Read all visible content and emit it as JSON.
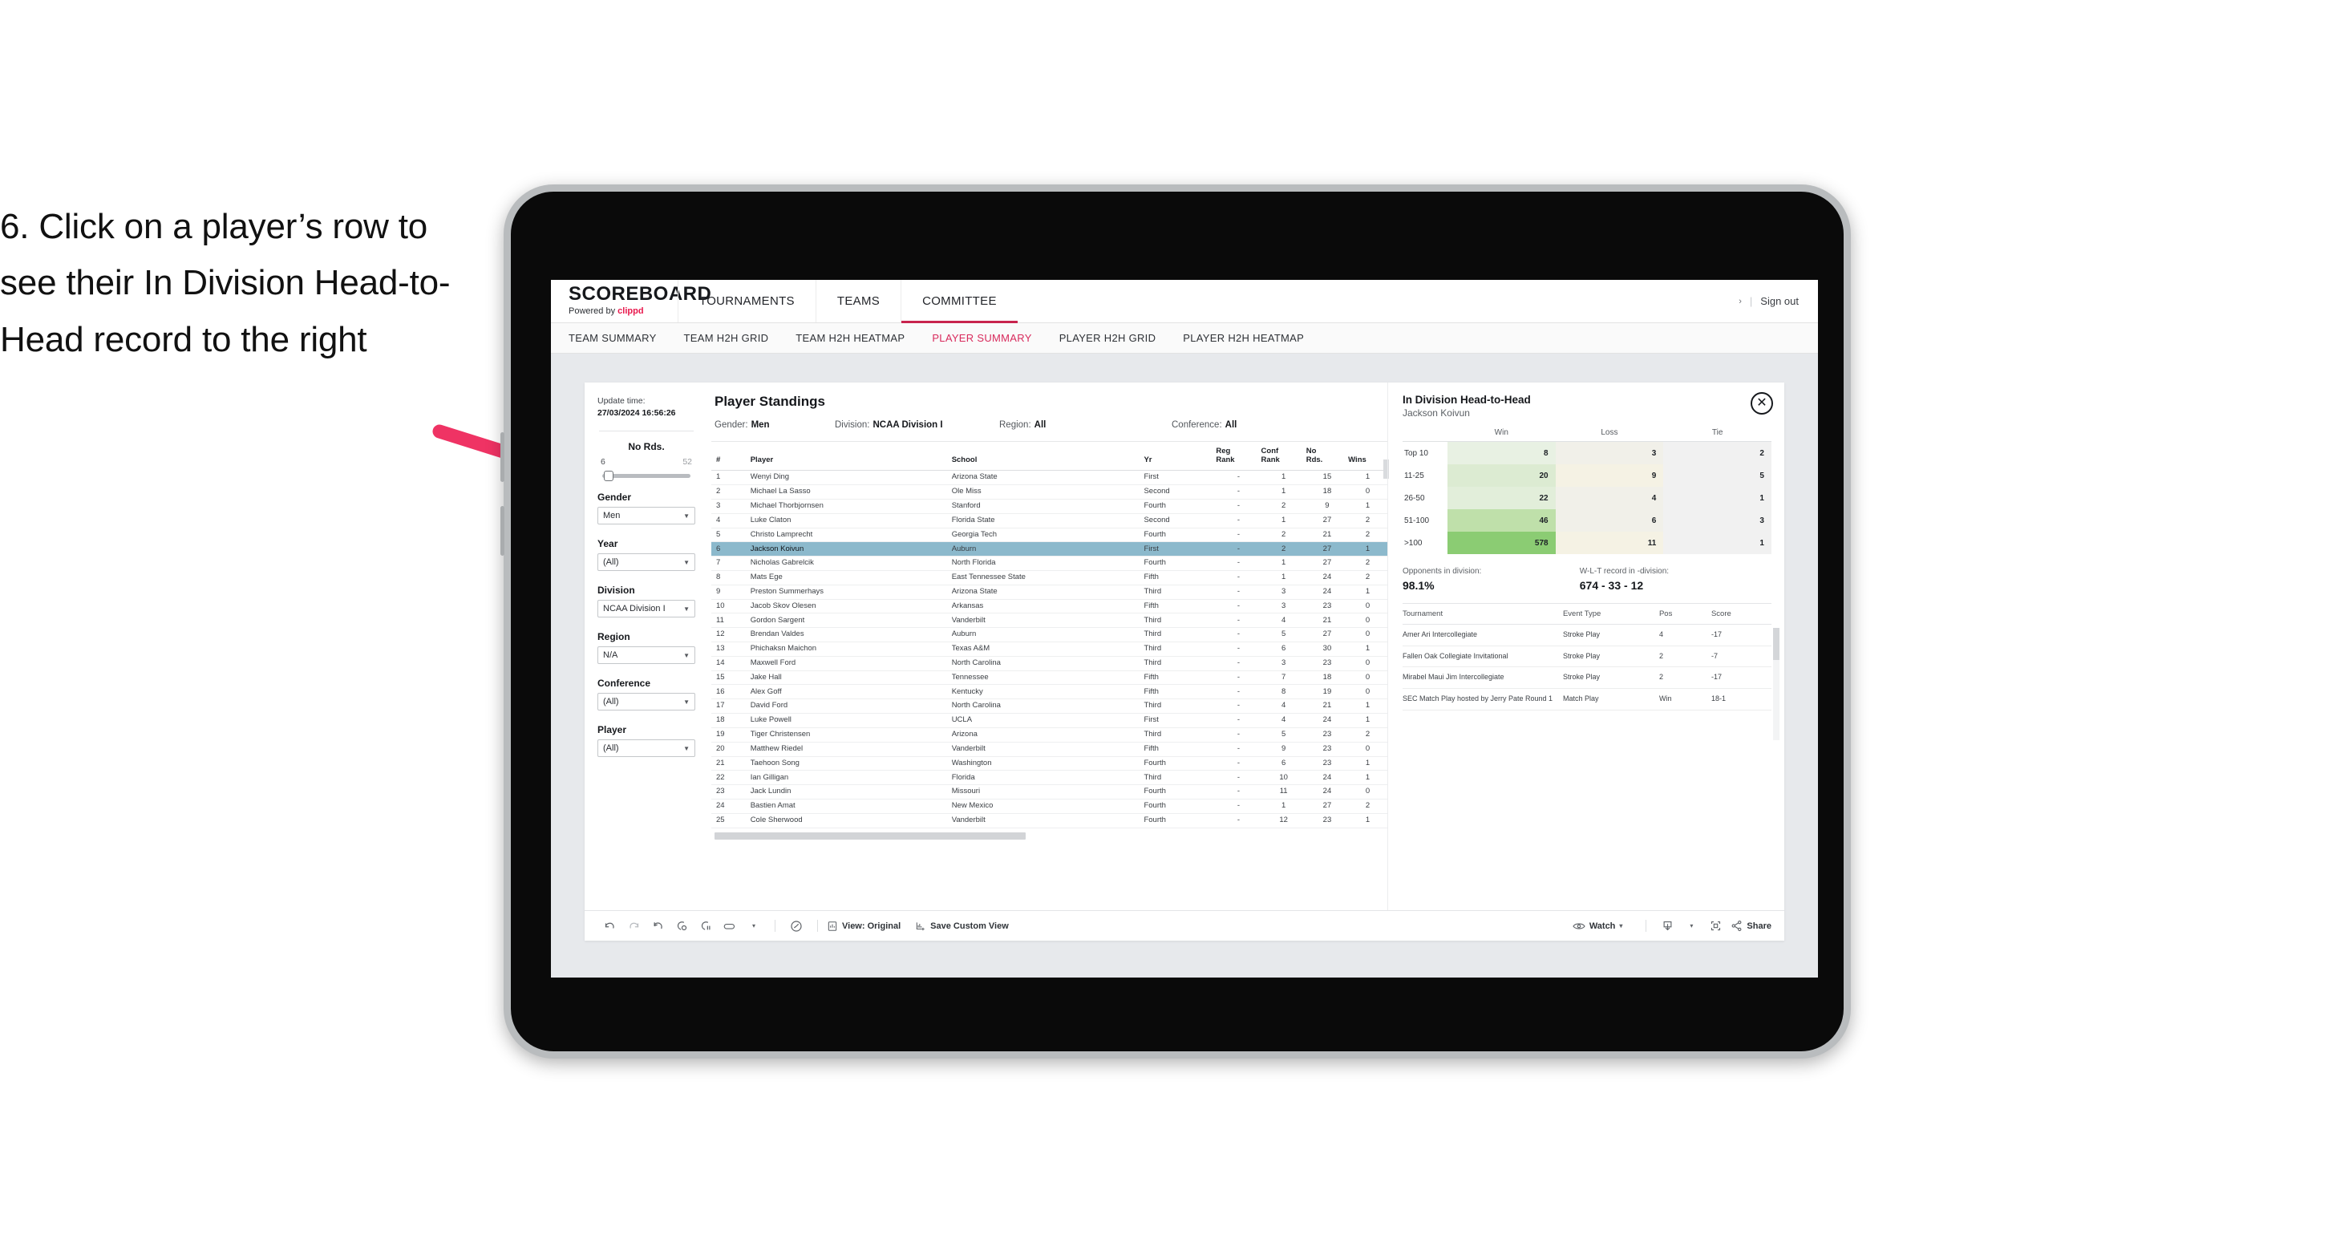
{
  "annotation": {
    "text": "6. Click on a player’s row to see their In Division Head-to-Head record to the right",
    "arrow_color": "#ef3364"
  },
  "brand": {
    "logo_main": "SCOREBOARD",
    "logo_sub_prefix": "Powered by ",
    "logo_sub_brand": "clippd",
    "accent": "#e8174c"
  },
  "topnav": {
    "items": [
      {
        "label": "TOURNAMENTS",
        "active": false
      },
      {
        "label": "TEAMS",
        "active": false
      },
      {
        "label": "COMMITTEE",
        "active": true
      }
    ],
    "chevron": "›",
    "separator": "|",
    "sign_out": "Sign out"
  },
  "subnav": {
    "items": [
      {
        "label": "TEAM SUMMARY",
        "active": false
      },
      {
        "label": "TEAM H2H GRID",
        "active": false
      },
      {
        "label": "TEAM H2H HEATMAP",
        "active": false
      },
      {
        "label": "PLAYER SUMMARY",
        "active": true
      },
      {
        "label": "PLAYER H2H GRID",
        "active": false
      },
      {
        "label": "PLAYER H2H HEATMAP",
        "active": false
      }
    ]
  },
  "sidebar": {
    "update_label": "Update time:",
    "update_value": "27/03/2024 16:56:26",
    "slider": {
      "title": "No Rds.",
      "min": "6",
      "max": "52"
    },
    "filters": [
      {
        "label": "Gender",
        "value": "Men"
      },
      {
        "label": "Year",
        "value": "(All)"
      },
      {
        "label": "Division",
        "value": "NCAA Division I"
      },
      {
        "label": "Region",
        "value": "N/A"
      },
      {
        "label": "Conference",
        "value": "(All)"
      },
      {
        "label": "Player",
        "value": "(All)"
      }
    ]
  },
  "standings": {
    "title": "Player Standings",
    "meta": [
      {
        "label": "Gender:",
        "value": "Men"
      },
      {
        "label": "Division:",
        "value": "NCAA Division I"
      },
      {
        "label": "Region:",
        "value": "All"
      },
      {
        "label": "Conference:",
        "value": "All"
      }
    ],
    "columns": [
      "#",
      "Player",
      "School",
      "Yr",
      "Reg Rank",
      "Conf Rank",
      "No Rds.",
      "Wins"
    ],
    "rows": [
      {
        "rank": "1",
        "player": "Wenyi Ding",
        "school": "Arizona State",
        "yr": "First",
        "reg": "-",
        "conf": "1",
        "rds": "15",
        "wins": "1",
        "selected": false
      },
      {
        "rank": "2",
        "player": "Michael La Sasso",
        "school": "Ole Miss",
        "yr": "Second",
        "reg": "-",
        "conf": "1",
        "rds": "18",
        "wins": "0",
        "selected": false
      },
      {
        "rank": "3",
        "player": "Michael Thorbjornsen",
        "school": "Stanford",
        "yr": "Fourth",
        "reg": "-",
        "conf": "2",
        "rds": "9",
        "wins": "1",
        "selected": false
      },
      {
        "rank": "4",
        "player": "Luke Claton",
        "school": "Florida State",
        "yr": "Second",
        "reg": "-",
        "conf": "1",
        "rds": "27",
        "wins": "2",
        "selected": false
      },
      {
        "rank": "5",
        "player": "Christo Lamprecht",
        "school": "Georgia Tech",
        "yr": "Fourth",
        "reg": "-",
        "conf": "2",
        "rds": "21",
        "wins": "2",
        "selected": false
      },
      {
        "rank": "6",
        "player": "Jackson Koivun",
        "school": "Auburn",
        "yr": "First",
        "reg": "-",
        "conf": "2",
        "rds": "27",
        "wins": "1",
        "selected": true
      },
      {
        "rank": "7",
        "player": "Nicholas Gabrelcik",
        "school": "North Florida",
        "yr": "Fourth",
        "reg": "-",
        "conf": "1",
        "rds": "27",
        "wins": "2",
        "selected": false
      },
      {
        "rank": "8",
        "player": "Mats Ege",
        "school": "East Tennessee State",
        "yr": "Fifth",
        "reg": "-",
        "conf": "1",
        "rds": "24",
        "wins": "2",
        "selected": false
      },
      {
        "rank": "9",
        "player": "Preston Summerhays",
        "school": "Arizona State",
        "yr": "Third",
        "reg": "-",
        "conf": "3",
        "rds": "24",
        "wins": "1",
        "selected": false
      },
      {
        "rank": "10",
        "player": "Jacob Skov Olesen",
        "school": "Arkansas",
        "yr": "Fifth",
        "reg": "-",
        "conf": "3",
        "rds": "23",
        "wins": "0",
        "selected": false
      },
      {
        "rank": "11",
        "player": "Gordon Sargent",
        "school": "Vanderbilt",
        "yr": "Third",
        "reg": "-",
        "conf": "4",
        "rds": "21",
        "wins": "0",
        "selected": false
      },
      {
        "rank": "12",
        "player": "Brendan Valdes",
        "school": "Auburn",
        "yr": "Third",
        "reg": "-",
        "conf": "5",
        "rds": "27",
        "wins": "0",
        "selected": false
      },
      {
        "rank": "13",
        "player": "Phichaksn Maichon",
        "school": "Texas A&M",
        "yr": "Third",
        "reg": "-",
        "conf": "6",
        "rds": "30",
        "wins": "1",
        "selected": false
      },
      {
        "rank": "14",
        "player": "Maxwell Ford",
        "school": "North Carolina",
        "yr": "Third",
        "reg": "-",
        "conf": "3",
        "rds": "23",
        "wins": "0",
        "selected": false
      },
      {
        "rank": "15",
        "player": "Jake Hall",
        "school": "Tennessee",
        "yr": "Fifth",
        "reg": "-",
        "conf": "7",
        "rds": "18",
        "wins": "0",
        "selected": false
      },
      {
        "rank": "16",
        "player": "Alex Goff",
        "school": "Kentucky",
        "yr": "Fifth",
        "reg": "-",
        "conf": "8",
        "rds": "19",
        "wins": "0",
        "selected": false
      },
      {
        "rank": "17",
        "player": "David Ford",
        "school": "North Carolina",
        "yr": "Third",
        "reg": "-",
        "conf": "4",
        "rds": "21",
        "wins": "1",
        "selected": false
      },
      {
        "rank": "18",
        "player": "Luke Powell",
        "school": "UCLA",
        "yr": "First",
        "reg": "-",
        "conf": "4",
        "rds": "24",
        "wins": "1",
        "selected": false
      },
      {
        "rank": "19",
        "player": "Tiger Christensen",
        "school": "Arizona",
        "yr": "Third",
        "reg": "-",
        "conf": "5",
        "rds": "23",
        "wins": "2",
        "selected": false
      },
      {
        "rank": "20",
        "player": "Matthew Riedel",
        "school": "Vanderbilt",
        "yr": "Fifth",
        "reg": "-",
        "conf": "9",
        "rds": "23",
        "wins": "0",
        "selected": false
      },
      {
        "rank": "21",
        "player": "Taehoon Song",
        "school": "Washington",
        "yr": "Fourth",
        "reg": "-",
        "conf": "6",
        "rds": "23",
        "wins": "1",
        "selected": false
      },
      {
        "rank": "22",
        "player": "Ian Gilligan",
        "school": "Florida",
        "yr": "Third",
        "reg": "-",
        "conf": "10",
        "rds": "24",
        "wins": "1",
        "selected": false
      },
      {
        "rank": "23",
        "player": "Jack Lundin",
        "school": "Missouri",
        "yr": "Fourth",
        "reg": "-",
        "conf": "11",
        "rds": "24",
        "wins": "0",
        "selected": false
      },
      {
        "rank": "24",
        "player": "Bastien Amat",
        "school": "New Mexico",
        "yr": "Fourth",
        "reg": "-",
        "conf": "1",
        "rds": "27",
        "wins": "2",
        "selected": false
      },
      {
        "rank": "25",
        "player": "Cole Sherwood",
        "school": "Vanderbilt",
        "yr": "Fourth",
        "reg": "-",
        "conf": "12",
        "rds": "23",
        "wins": "1",
        "selected": false
      }
    ]
  },
  "h2h": {
    "title": "In Division Head-to-Head",
    "player": "Jackson Koivun",
    "close_icon": "close-icon",
    "opponents_label": "Opponents in division:",
    "opponents_value": "98.1%",
    "record_label": "W-L-T record in -division:",
    "record_value": "674 - 33 - 12",
    "tournament_columns": [
      "Tournament",
      "Event Type",
      "Pos",
      "Score"
    ],
    "tournaments": [
      {
        "name": "Amer Ari Intercollegiate",
        "type": "Stroke Play",
        "pos": "4",
        "score": "-17"
      },
      {
        "name": "Fallen Oak Collegiate Invitational",
        "type": "Stroke Play",
        "pos": "2",
        "score": "-7"
      },
      {
        "name": "Mirabel Maui Jim Intercollegiate",
        "type": "Stroke Play",
        "pos": "2",
        "score": "-17"
      },
      {
        "name": "SEC Match Play hosted by Jerry Pate Round 1",
        "type": "Match Play",
        "pos": "Win",
        "score": "18-1"
      }
    ]
  },
  "chart_data": {
    "type": "heatmap",
    "title": "In Division Head-to-Head",
    "subtitle": "Jackson Koivun",
    "xlabel": "",
    "ylabel": "",
    "columns": [
      "Win",
      "Loss",
      "Tie"
    ],
    "categories": [
      "Top 10",
      "11-25",
      "26-50",
      "51-100",
      ">100"
    ],
    "values": [
      [
        8,
        3,
        2
      ],
      [
        20,
        9,
        5
      ],
      [
        22,
        4,
        1
      ],
      [
        46,
        6,
        3
      ],
      [
        578,
        11,
        1
      ]
    ],
    "cell_colors": [
      [
        "#e8f1e3",
        "#f1f0e9",
        "#f1f1f1"
      ],
      [
        "#dcebd2",
        "#f5f2e4",
        "#f1f1f1"
      ],
      [
        "#e2eeda",
        "#f1f0e9",
        "#f1f1f1"
      ],
      [
        "#bfe0aa",
        "#f1f0e9",
        "#f1f1f1"
      ],
      [
        "#8bcc73",
        "#f5f2e4",
        "#f1f1f1"
      ]
    ],
    "legend_position": "top",
    "grid": false
  },
  "toolbar": {
    "icons": [
      "undo-icon",
      "redo-icon",
      "revert-icon",
      "refresh-icon",
      "pause-icon",
      "highlight-icon"
    ],
    "highlight_caret": "▾",
    "clock_icon": "dashboard-icon",
    "view_icon": "view-icon",
    "view_label": "View: Original",
    "save_icon": "save-view-icon",
    "save_label": "Save Custom View",
    "watch_icon": "eye-icon",
    "watch_label": "Watch",
    "watch_caret": "▾",
    "download_icon": "download-icon",
    "download_caret": "▾",
    "fullscreen_icon": "fullscreen-icon",
    "share_icon": "share-icon",
    "share_label": "Share"
  }
}
